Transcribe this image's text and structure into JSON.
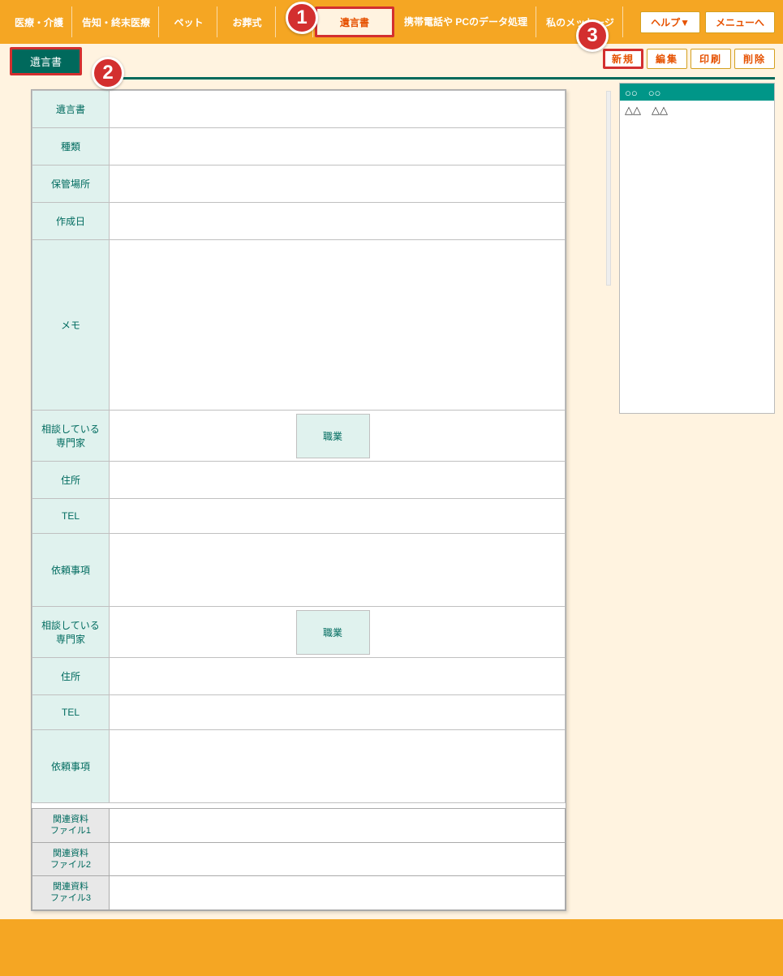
{
  "nav": {
    "tabs": [
      "医療・介護",
      "告知・終末医療",
      "ペット",
      "お葬式",
      "",
      "遺言書",
      "携帯電話や\nPCのデータ処理",
      "私のメッセージ"
    ],
    "highlighted_index": 5,
    "help": "ヘルプ▼",
    "menu": "メニューへ"
  },
  "section": {
    "tag": "遺言書"
  },
  "actions": {
    "btns": [
      "新規",
      "編集",
      "印刷",
      "削除"
    ],
    "highlighted_index": 0
  },
  "form": {
    "rows": [
      {
        "label": "遺言書"
      },
      {
        "label": "種類"
      },
      {
        "label": "保管場所"
      },
      {
        "label": "作成日"
      },
      {
        "label": "メモ",
        "tall": true
      },
      {
        "label": "相談している\n専門家",
        "sub_label": "職業",
        "mid": true
      },
      {
        "label": "住所"
      },
      {
        "label": "TEL"
      },
      {
        "label": "依頼事項",
        "med": true
      },
      {
        "label": "相談している\n専門家",
        "sub_label": "職業",
        "mid": true
      },
      {
        "label": "住所"
      },
      {
        "label": "TEL"
      },
      {
        "label": "依頼事項",
        "med": true
      }
    ],
    "attachments": [
      "関連資料\nファイル1",
      "関連資料\nファイル2",
      "関連資料\nファイル3"
    ]
  },
  "sidebar": {
    "items": [
      "○○　○○",
      "△△　△△"
    ]
  },
  "callouts": {
    "c1": "1",
    "c2": "2",
    "c3": "3"
  }
}
